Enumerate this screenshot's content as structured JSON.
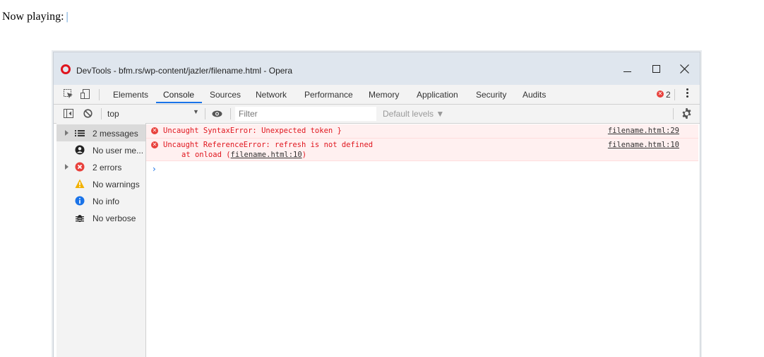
{
  "page": {
    "now_playing_label": "Now playing:",
    "caret": "|"
  },
  "window": {
    "title": "DevTools - bfm.rs/wp-content/jazler/filename.html - Opera"
  },
  "tabs": [
    {
      "label": "Elements"
    },
    {
      "label": "Console"
    },
    {
      "label": "Sources"
    },
    {
      "label": "Network"
    },
    {
      "label": "Performance"
    },
    {
      "label": "Memory"
    },
    {
      "label": "Application"
    },
    {
      "label": "Security"
    },
    {
      "label": "Audits"
    }
  ],
  "active_tab": "Console",
  "error_count": "2",
  "filterbar": {
    "context": "top",
    "filter_placeholder": "Filter",
    "levels": "Default levels ▼"
  },
  "sidebar": {
    "items": [
      {
        "label": "2 messages",
        "icon": "list-icon"
      },
      {
        "label": "No user me...",
        "icon": "user-icon"
      },
      {
        "label": "2 errors",
        "icon": "error-icon"
      },
      {
        "label": "No warnings",
        "icon": "warning-icon"
      },
      {
        "label": "No info",
        "icon": "info-icon"
      },
      {
        "label": "No verbose",
        "icon": "bug-icon"
      }
    ]
  },
  "messages": [
    {
      "text": "Uncaught SyntaxError: Unexpected token }",
      "source": "filename.html:29"
    },
    {
      "text": "Uncaught ReferenceError: refresh is not defined",
      "source": "filename.html:10",
      "stack_prefix": "at onload (",
      "stack_link": "filename.html:10",
      "stack_suffix": ")"
    }
  ],
  "colors": {
    "accent": "#1a73e8",
    "error": "#e8413c",
    "titlebar": "#dfe6ee"
  }
}
